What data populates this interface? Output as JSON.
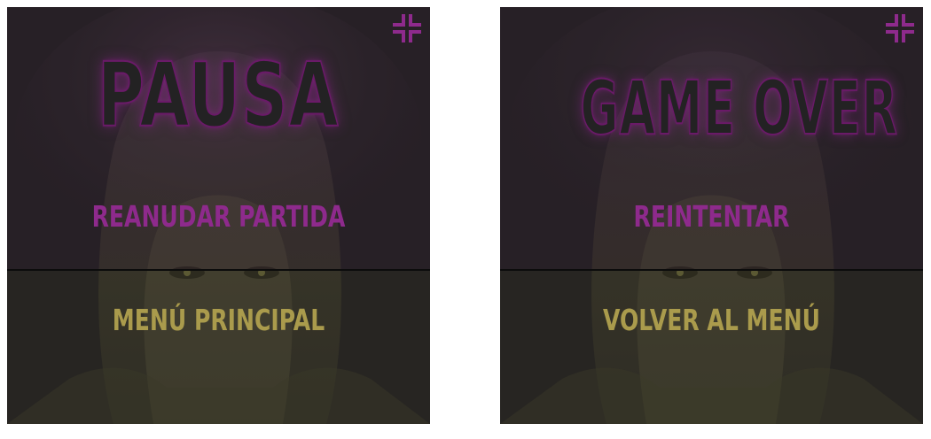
{
  "pause_screen": {
    "title": "PAUSA",
    "primary_button_label": "REANUDAR PARTIDA",
    "secondary_button_label": "MENÚ PRINCIPAL",
    "corner_icon": "minimize-icon"
  },
  "gameover_screen": {
    "title": "GAME OVER",
    "primary_button_label": "REINTENTAR",
    "secondary_button_label": "VOLVER AL MENÚ",
    "corner_icon": "minimize-icon"
  },
  "colors": {
    "panel_background": "#232223",
    "accent_magenta": "#8e2a8c",
    "accent_gold": "#aa9b4c",
    "title_outline": "#6a1a68"
  }
}
